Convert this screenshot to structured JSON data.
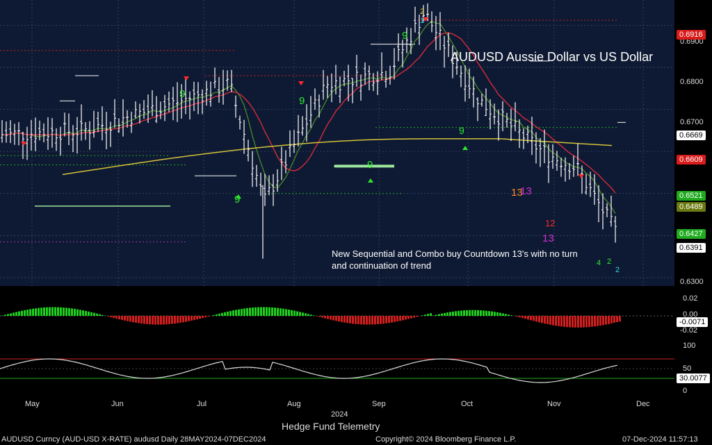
{
  "title": "AUDUSD Aussie Dollar vs US Dollar",
  "annotation_line1": "New Sequential and Combo buy Countdown 13's with no turn",
  "annotation_line2": "and continuation of trend",
  "year_label": "2024",
  "bottom_caption": "Hedge Fund Telemetry",
  "footer": {
    "left": "AUDUSD Curncy (AUD-USD X-RATE) audusd  Daily 28MAY2024-07DEC2024",
    "center": "Copyright© 2024 Bloomberg Finance L.P.",
    "right": "07-Dec-2024 11:57:13"
  },
  "x_months": [
    "May",
    "Jun",
    "Jul",
    "Aug",
    "Sep",
    "Oct",
    "Nov",
    "Dec"
  ],
  "price_axis_ticks": [
    "0.6900",
    "0.6800",
    "0.6700",
    "0.6300"
  ],
  "price_tags": [
    {
      "text": "0.6916",
      "bg": "#d81b1b"
    },
    {
      "text": "0.6669",
      "bg": "#ffffff",
      "fg": "#000"
    },
    {
      "text": "0.6609",
      "bg": "#d81b1b"
    },
    {
      "text": "0.6521",
      "bg": "#1faa1f"
    },
    {
      "text": "0.6489",
      "bg": "#6b7a10"
    },
    {
      "text": "0.6427",
      "bg": "#1faa1f"
    },
    {
      "text": "0.6391",
      "bg": "#ffffff",
      "fg": "#000"
    }
  ],
  "macd_axis": [
    "0.02",
    "0.00",
    "-0.02"
  ],
  "macd_tag": "-0.0071",
  "rsi_axis": [
    "100",
    "50",
    "0"
  ],
  "rsi_tag": "30.0077",
  "colors": {
    "background": "#0e1a33",
    "price_bar": "#ffffff",
    "ma50": "#d42a3c",
    "ma200": "#d4c23a",
    "ma20": "#4a8a2a",
    "setup_green": "#2ee82e",
    "countdown_red": "#ff2a2a",
    "countdown_magenta": "#d12ed1",
    "countdown_orange": "#ff8a1e"
  },
  "chart_data": {
    "type": "line",
    "title": "AUDUSD Aussie Dollar vs US Dollar",
    "ylim": [
      0.628,
      0.696
    ],
    "x": [
      "2024-05-28",
      "2024-06-15",
      "2024-07-01",
      "2024-07-15",
      "2024-08-05",
      "2024-08-20",
      "2024-09-05",
      "2024-09-30",
      "2024-10-15",
      "2024-11-01",
      "2024-11-15",
      "2024-12-06"
    ],
    "series": [
      {
        "values": [
          0.664,
          0.665,
          0.672,
          0.676,
          0.648,
          0.676,
          0.679,
          0.693,
          0.672,
          0.66,
          0.656,
          0.641
        ]
      }
    ],
    "last": 0.6391
  }
}
